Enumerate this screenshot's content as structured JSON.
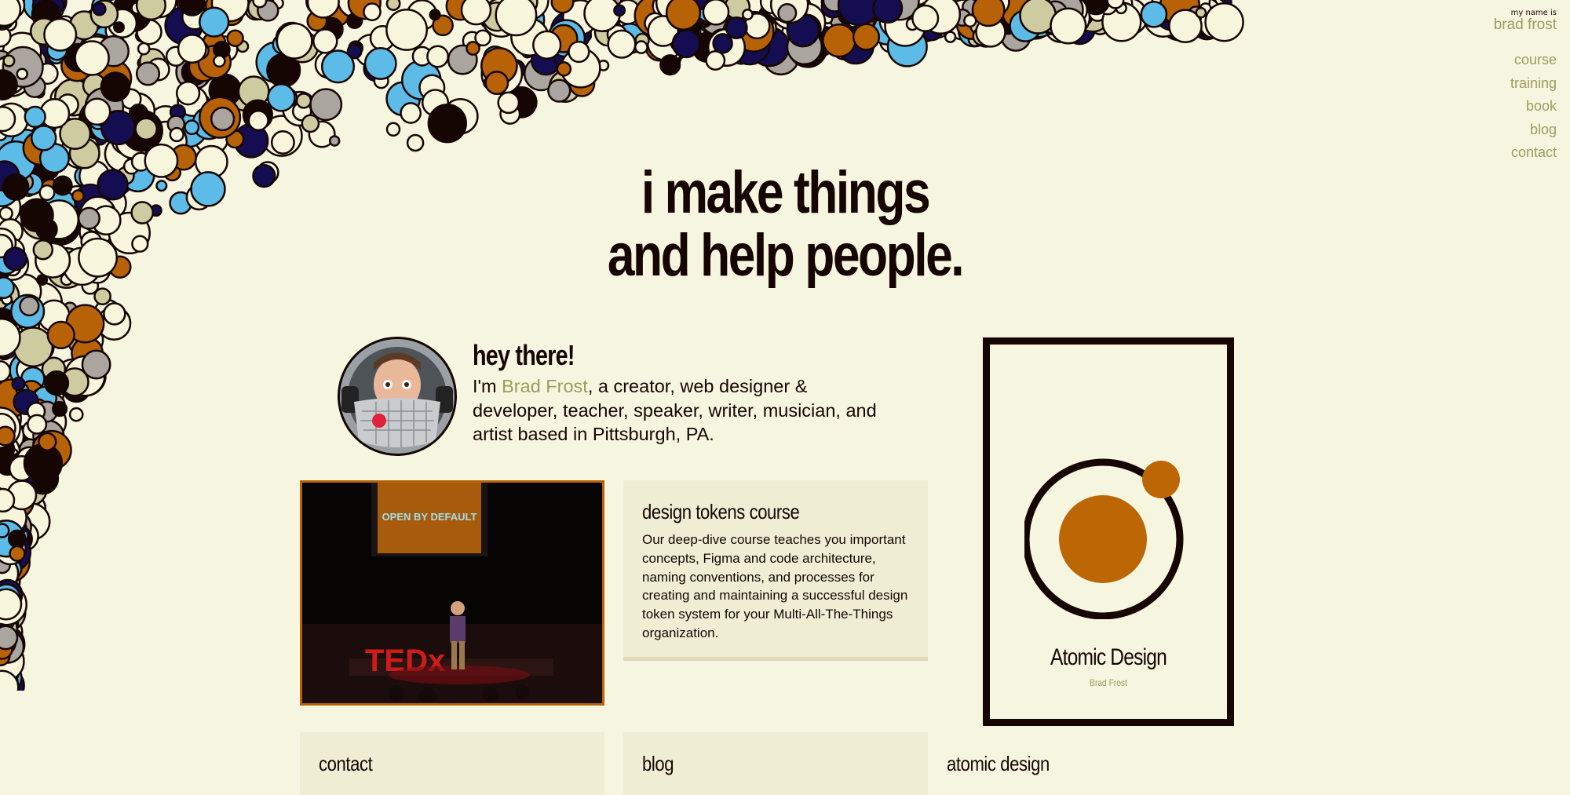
{
  "header": {
    "myname_label": "my name is",
    "name": "brad frost",
    "nav": [
      {
        "label": "course"
      },
      {
        "label": "training"
      },
      {
        "label": "book"
      },
      {
        "label": "blog"
      },
      {
        "label": "contact"
      }
    ]
  },
  "hero": {
    "line1": "i make things",
    "line2": "and help people."
  },
  "intro": {
    "heading": "hey there!",
    "text_before": "I'm ",
    "name_link": "Brad Frost",
    "text_after": ", a creator, web designer & developer, teacher, speaker, writer, musician, and artist based in Pittsburgh, PA."
  },
  "ted_card": {
    "slide_text": "OPEN BY DEFAULT",
    "stage_letters": "TEDx"
  },
  "tokens_card": {
    "title": "design tokens course",
    "text": "Our deep-dive course teaches you important concepts, Figma and code architecture, naming conventions, and processes for creating and maintaining a successful design token system for your Multi-All-The-Things organization."
  },
  "book_card": {
    "title": "Atomic Design",
    "author": "Brad Frost"
  },
  "bottom_cards": {
    "contact_title": "contact",
    "blog_title": "blog",
    "atomic_title": "atomic design"
  },
  "colors": {
    "background": "#f6f5df",
    "ink": "#150604",
    "accent": "#9c9c5f",
    "orange": "#b86207",
    "navy": "#150d52",
    "sky": "#5dbbe8",
    "cream": "#f7f5dc",
    "gray": "#aba59f",
    "khaki": "#cfcba0"
  }
}
